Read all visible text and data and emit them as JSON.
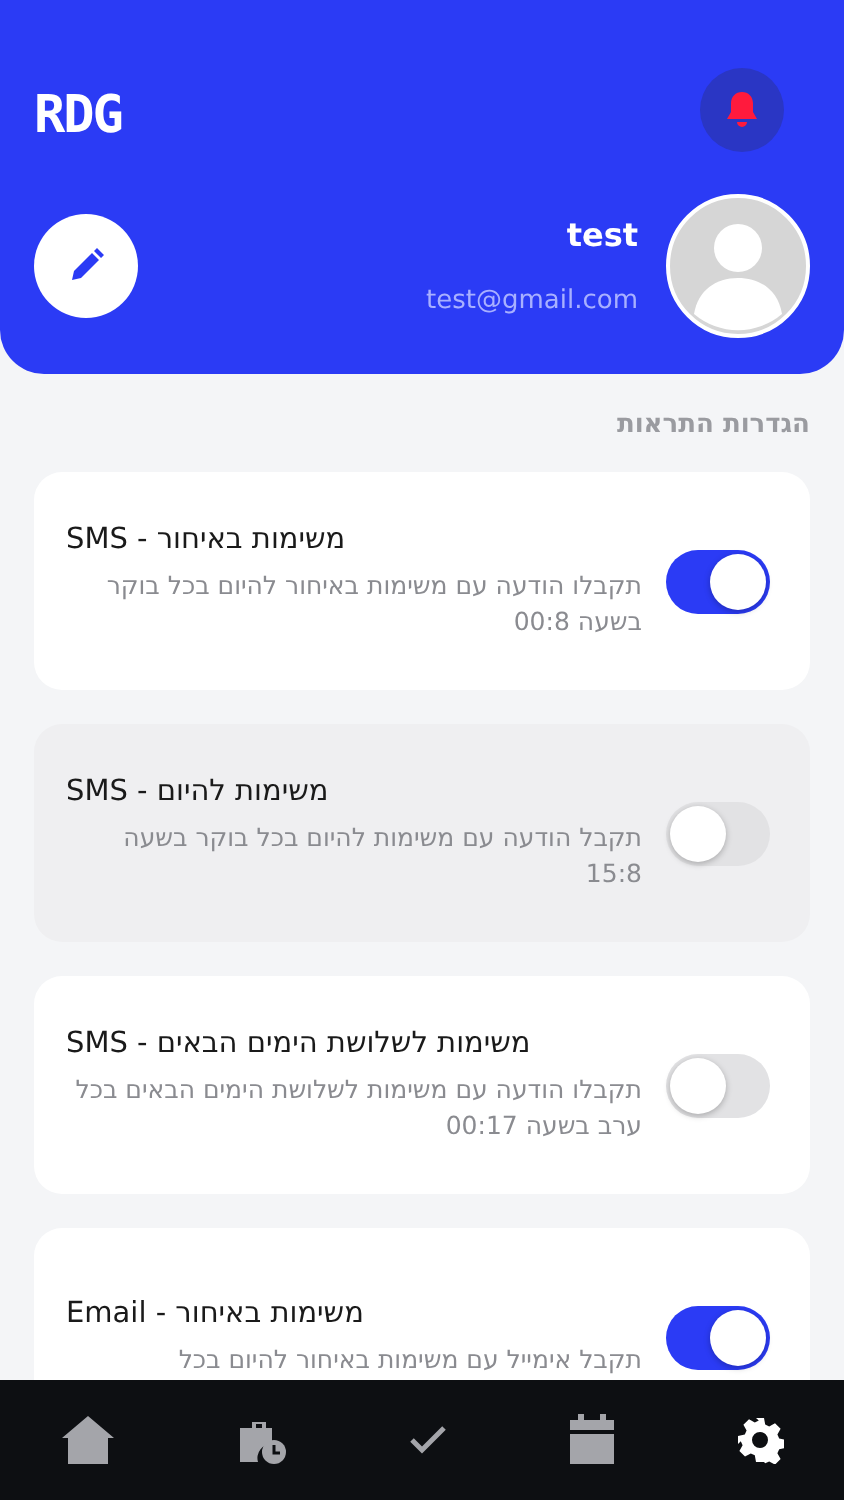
{
  "header": {
    "logo": "RDG",
    "user_name": "test",
    "user_email": "test@gmail.com"
  },
  "section_title": "הגדרות התראות",
  "settings": [
    {
      "title": "משימות באיחור - SMS",
      "description": "תקבלו הודעה עם משימות באיחור להיום בכל בוקר בשעה 00:8",
      "on": true,
      "pressed": false
    },
    {
      "title": "משימות להיום - SMS",
      "description": "תקבל הודעה עם משימות להיום בכל בוקר בשעה 15:8",
      "on": false,
      "pressed": true
    },
    {
      "title": "משימות לשלושת הימים הבאים - SMS",
      "description": "תקבלו הודעה עם משימות לשלושת הימים הבאים בכל ערב בשעה 00:17",
      "on": false,
      "pressed": false
    },
    {
      "title": "משימות באיחור - Email",
      "description": "תקבל אימייל עם משימות באיחור להיום בכל",
      "on": true,
      "pressed": false
    }
  ],
  "nav": [
    {
      "kind": "home",
      "selected": false
    },
    {
      "kind": "work",
      "selected": false
    },
    {
      "kind": "tasks",
      "selected": false
    },
    {
      "kind": "calendar",
      "selected": false
    },
    {
      "kind": "settings",
      "selected": true
    }
  ]
}
